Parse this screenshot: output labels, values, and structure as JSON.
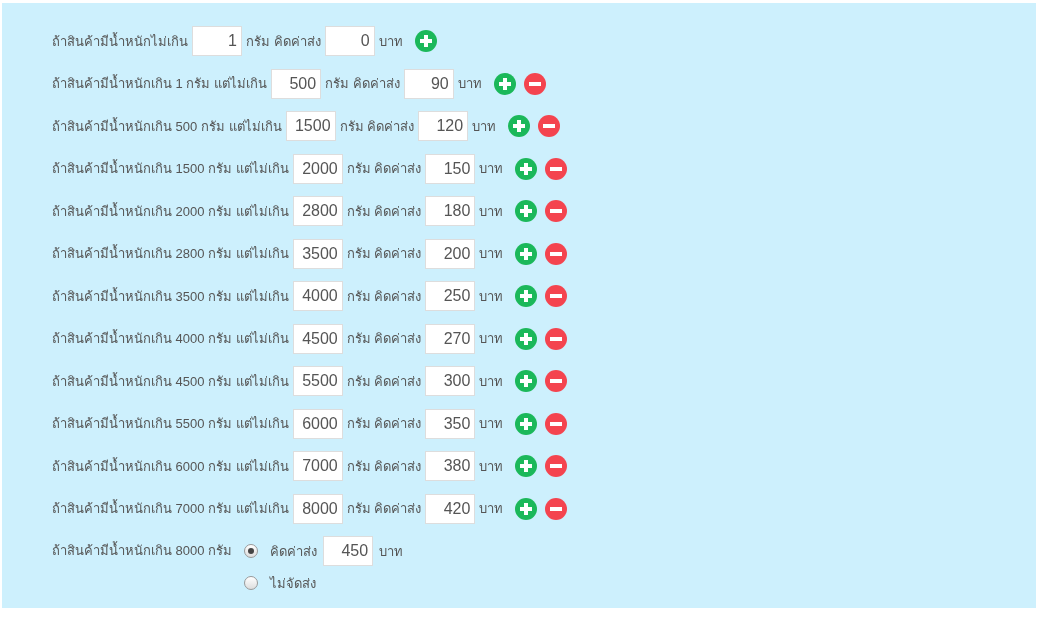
{
  "rows": [
    {
      "condition": "ถ้าสินค้ามีน้ำหนักไม่เกิน",
      "weight": "1",
      "middle": "กรัม คิดค่าส่ง",
      "cost": "0",
      "currency": "บาท",
      "removable": false
    },
    {
      "condition": "ถ้าสินค้ามีน้ำหนักเกิน 1 กรัม แต่ไม่เกิน",
      "weight": "500",
      "middle": "กรัม คิดค่าส่ง",
      "cost": "90",
      "currency": "บาท",
      "removable": true
    },
    {
      "condition": "ถ้าสินค้ามีน้ำหนักเกิน 500 กรัม แต่ไม่เกิน",
      "weight": "1500",
      "middle": "กรัม คิดค่าส่ง",
      "cost": "120",
      "currency": "บาท",
      "removable": true
    },
    {
      "condition": "ถ้าสินค้ามีน้ำหนักเกิน 1500 กรัม แต่ไม่เกิน",
      "weight": "2000",
      "middle": "กรัม คิดค่าส่ง",
      "cost": "150",
      "currency": "บาท",
      "removable": true
    },
    {
      "condition": "ถ้าสินค้ามีน้ำหนักเกิน 2000 กรัม แต่ไม่เกิน",
      "weight": "2800",
      "middle": "กรัม คิดค่าส่ง",
      "cost": "180",
      "currency": "บาท",
      "removable": true
    },
    {
      "condition": "ถ้าสินค้ามีน้ำหนักเกิน 2800 กรัม แต่ไม่เกิน",
      "weight": "3500",
      "middle": "กรัม คิดค่าส่ง",
      "cost": "200",
      "currency": "บาท",
      "removable": true
    },
    {
      "condition": "ถ้าสินค้ามีน้ำหนักเกิน 3500 กรัม แต่ไม่เกิน",
      "weight": "4000",
      "middle": "กรัม คิดค่าส่ง",
      "cost": "250",
      "currency": "บาท",
      "removable": true
    },
    {
      "condition": "ถ้าสินค้ามีน้ำหนักเกิน 4000 กรัม แต่ไม่เกิน",
      "weight": "4500",
      "middle": "กรัม คิดค่าส่ง",
      "cost": "270",
      "currency": "บาท",
      "removable": true
    },
    {
      "condition": "ถ้าสินค้ามีน้ำหนักเกิน 4500 กรัม แต่ไม่เกิน",
      "weight": "5500",
      "middle": "กรัม คิดค่าส่ง",
      "cost": "300",
      "currency": "บาท",
      "removable": true
    },
    {
      "condition": "ถ้าสินค้ามีน้ำหนักเกิน 5500 กรัม แต่ไม่เกิน",
      "weight": "6000",
      "middle": "กรัม คิดค่าส่ง",
      "cost": "350",
      "currency": "บาท",
      "removable": true
    },
    {
      "condition": "ถ้าสินค้ามีน้ำหนักเกิน 6000 กรัม แต่ไม่เกิน",
      "weight": "7000",
      "middle": "กรัม คิดค่าส่ง",
      "cost": "380",
      "currency": "บาท",
      "removable": true
    },
    {
      "condition": "ถ้าสินค้ามีน้ำหนักเกิน 7000 กรัม แต่ไม่เกิน",
      "weight": "8000",
      "middle": "กรัม คิดค่าส่ง",
      "cost": "420",
      "currency": "บาท",
      "removable": true
    }
  ],
  "final": {
    "condition": "ถ้าสินค้ามีน้ำหนักเกิน 8000 กรัม",
    "options": [
      {
        "label": "คิดค่าส่ง",
        "selected": true,
        "cost": "450",
        "currency": "บาท"
      },
      {
        "label": "ไม่จัดส่ง",
        "selected": false
      }
    ]
  }
}
